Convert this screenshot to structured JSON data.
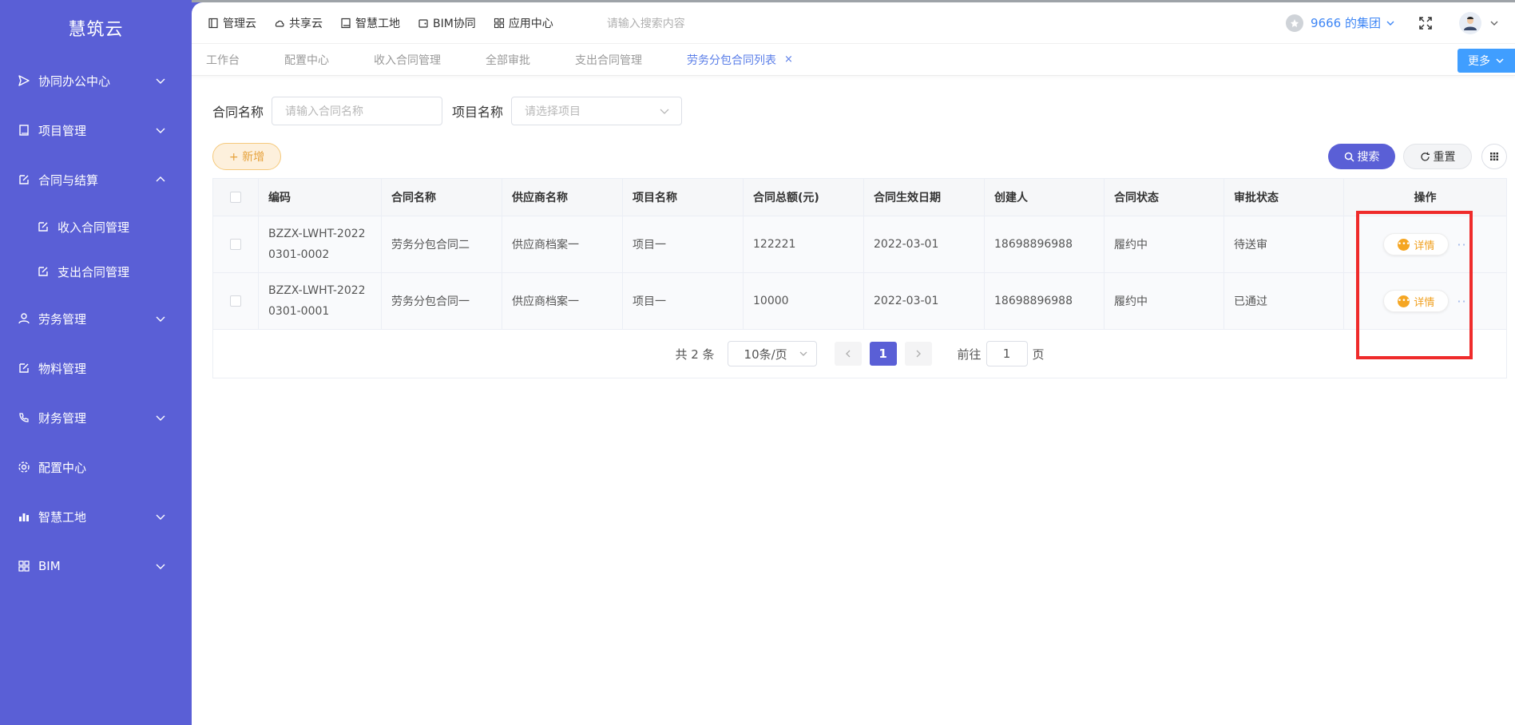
{
  "sidebar": {
    "brand": "慧筑云",
    "items": [
      {
        "label": "协同办公中心",
        "icon": "send-icon",
        "chevron": "down"
      },
      {
        "label": "项目管理",
        "icon": "book-icon",
        "chevron": "down"
      },
      {
        "label": "合同与结算",
        "icon": "edit-icon",
        "chevron": "up"
      },
      {
        "label": "收入合同管理",
        "icon": "edit-icon",
        "sub": true
      },
      {
        "label": "支出合同管理",
        "icon": "edit-icon",
        "sub": true
      },
      {
        "label": "劳务管理",
        "icon": "user-icon",
        "chevron": "down"
      },
      {
        "label": "物料管理",
        "icon": "edit-icon",
        "chevron": ""
      },
      {
        "label": "财务管理",
        "icon": "phone-icon",
        "chevron": "down"
      },
      {
        "label": "配置中心",
        "icon": "gear-icon",
        "chevron": ""
      },
      {
        "label": "智慧工地",
        "icon": "bar-chart-icon",
        "chevron": "down"
      },
      {
        "label": "BIM",
        "icon": "grid-icon",
        "chevron": "down"
      }
    ]
  },
  "topbar": {
    "links": [
      "管理云",
      "共享云",
      "智慧工地",
      "BIM协同",
      "应用中心"
    ],
    "search_placeholder": "请输入搜索内容",
    "org": "9666 的集团"
  },
  "tabs": {
    "items": [
      "工作台",
      "配置中心",
      "收入合同管理",
      "全部审批",
      "支出合同管理",
      "劳务分包合同列表"
    ],
    "active": "劳务分包合同列表",
    "close": "×",
    "more": "更多"
  },
  "filter": {
    "contract_label": "合同名称",
    "contract_placeholder": "请输入合同名称",
    "project_label": "项目名称",
    "project_placeholder": "请选择项目"
  },
  "actions": {
    "add": "+ 新增",
    "search": "搜索",
    "reset": "重置"
  },
  "table": {
    "headers": [
      "编码",
      "合同名称",
      "供应商名称",
      "项目名称",
      "合同总额(元)",
      "合同生效日期",
      "创建人",
      "合同状态",
      "审批状态",
      "操作"
    ],
    "rows": [
      {
        "code": "BZZX-LWHT-20220301-0002",
        "name": "劳务分包合同二",
        "supplier": "供应商档案一",
        "project": "项目一",
        "amount": "122221",
        "date": "2022-03-01",
        "creator": "18698896988",
        "status": "履约中",
        "approval": "待送审",
        "action": "详情"
      },
      {
        "code": "BZZX-LWHT-20220301-0001",
        "name": "劳务分包合同一",
        "supplier": "供应商档案一",
        "project": "项目一",
        "amount": "10000",
        "date": "2022-03-01",
        "creator": "18698896988",
        "status": "履约中",
        "approval": "已通过",
        "action": "详情"
      }
    ]
  },
  "pager": {
    "total": "共 2 条",
    "page_size": "10条/页",
    "current": "1",
    "goto_label": "前往",
    "goto_value": "1",
    "page_suffix": "页"
  },
  "colors": {
    "sidebar": "#5a5fd6",
    "accent": "#409eff",
    "highlight": "#ef2b2b",
    "warning": "#f0a020"
  }
}
